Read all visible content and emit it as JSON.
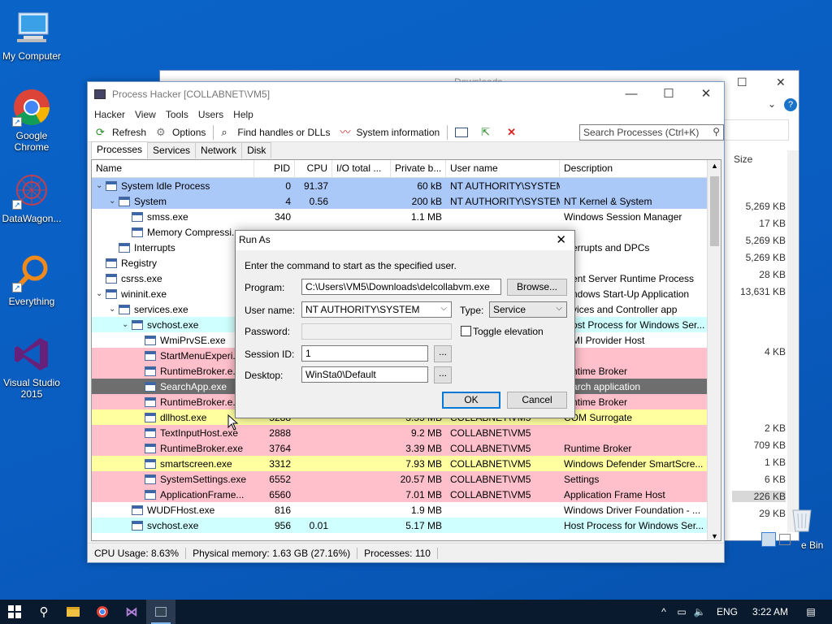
{
  "desktop": {
    "icons": [
      {
        "label": "My Computer",
        "icon": "computer-icon"
      },
      {
        "label": "Google Chrome",
        "icon": "chrome-icon"
      },
      {
        "label": "DataWagon...",
        "icon": "datawagon-icon"
      },
      {
        "label": "Everything",
        "icon": "magnifier-icon"
      },
      {
        "label": "Visual Studio 2015",
        "icon": "visual-studio-icon"
      }
    ]
  },
  "explorer": {
    "title": "Downloads",
    "size_header": "Size",
    "sizes": [
      "5,269 KB",
      "17 KB",
      "5,269 KB",
      "5,269 KB",
      "28 KB",
      "13,631 KB",
      "4 KB",
      "2 KB",
      "709 KB",
      "1 KB",
      "6 KB",
      "226 KB",
      "29 KB"
    ],
    "recycle_bin_partial": "e Bin"
  },
  "process_hacker": {
    "title": "Process Hacker [COLLABNET\\VM5]",
    "menu": [
      "Hacker",
      "View",
      "Tools",
      "Users",
      "Help"
    ],
    "toolbar": {
      "refresh": "Refresh",
      "options": "Options",
      "find_handles": "Find handles or DLLs",
      "system_information": "System information"
    },
    "search_placeholder": "Search Processes (Ctrl+K)",
    "tabs": [
      "Processes",
      "Services",
      "Network",
      "Disk"
    ],
    "columns": {
      "name": "Name",
      "pid": "PID",
      "cpu": "CPU",
      "io": "I/O total ...",
      "private": "Private b...",
      "user": "User name",
      "description": "Description"
    },
    "colors": {
      "system_blue": "#aac8f8",
      "service_cyan": "#d0ffff",
      "immersive_pink": "#ffc0cb",
      "dll_yellow": "#ffffa0",
      "selected_dark": "#6e6e6e"
    },
    "processes": [
      {
        "name": "System Idle Process",
        "indent": 0,
        "expand": "v",
        "pid": "0",
        "cpu": "91.37",
        "io": "",
        "priv": "60 kB",
        "user": "NT AUTHORITY\\SYSTEM",
        "desc": "",
        "color": "blue"
      },
      {
        "name": "System",
        "indent": 1,
        "expand": "v",
        "pid": "4",
        "cpu": "0.56",
        "io": "",
        "priv": "200 kB",
        "user": "NT AUTHORITY\\SYSTEM",
        "desc": "NT Kernel & System",
        "color": "blue"
      },
      {
        "name": "smss.exe",
        "indent": 2,
        "expand": "",
        "pid": "340",
        "cpu": "",
        "io": "",
        "priv": "1.1 MB",
        "user": "",
        "desc": "Windows Session Manager",
        "color": ""
      },
      {
        "name": "Memory Compressi...",
        "indent": 2,
        "expand": "",
        "pid": "",
        "cpu": "",
        "io": "",
        "priv": "",
        "user": "",
        "desc": "",
        "color": ""
      },
      {
        "name": "Interrupts",
        "indent": 1,
        "expand": "",
        "pid": "",
        "cpu": "",
        "io": "",
        "priv": "",
        "user": "",
        "desc": "...errupts and DPCs",
        "color": ""
      },
      {
        "name": "Registry",
        "indent": 0,
        "expand": "",
        "pid": "",
        "cpu": "",
        "io": "",
        "priv": "",
        "user": "",
        "desc": "",
        "color": ""
      },
      {
        "name": "csrss.exe",
        "indent": 0,
        "expand": "",
        "pid": "",
        "cpu": "",
        "io": "",
        "priv": "",
        "user": "",
        "desc": "...ent Server Runtime Process",
        "color": ""
      },
      {
        "name": "wininit.exe",
        "indent": 0,
        "expand": "v",
        "pid": "",
        "cpu": "",
        "io": "",
        "priv": "",
        "user": "",
        "desc": "...ndows Start-Up Application",
        "color": ""
      },
      {
        "name": "services.exe",
        "indent": 1,
        "expand": "v",
        "pid": "",
        "cpu": "",
        "io": "",
        "priv": "",
        "user": "",
        "desc": "...vices and Controller app",
        "color": ""
      },
      {
        "name": "svchost.exe",
        "indent": 2,
        "expand": "v",
        "pid": "",
        "cpu": "",
        "io": "",
        "priv": "",
        "user": "",
        "desc": "...ost Process for Windows Ser...",
        "color": "cyan"
      },
      {
        "name": "WmiPrvSE.exe",
        "indent": 3,
        "expand": "",
        "pid": "",
        "cpu": "",
        "io": "",
        "priv": "",
        "user": "",
        "desc": "...MI Provider Host",
        "color": ""
      },
      {
        "name": "StartMenuExperi...",
        "indent": 3,
        "expand": "",
        "pid": "",
        "cpu": "",
        "io": "",
        "priv": "",
        "user": "",
        "desc": "",
        "color": "pink"
      },
      {
        "name": "RuntimeBroker.e...",
        "indent": 3,
        "expand": "",
        "pid": "",
        "cpu": "",
        "io": "",
        "priv": "",
        "user": "",
        "desc": "...ntime Broker",
        "color": "pink"
      },
      {
        "name": "SearchApp.exe",
        "indent": 3,
        "expand": "",
        "pid": "",
        "cpu": "",
        "io": "",
        "priv": "",
        "user": "",
        "desc": "...arch application",
        "color": "selected"
      },
      {
        "name": "RuntimeBroker.e...",
        "indent": 3,
        "expand": "",
        "pid": "",
        "cpu": "",
        "io": "",
        "priv": "",
        "user": "",
        "desc": "...ntime Broker",
        "color": "pink"
      },
      {
        "name": "dllhost.exe",
        "indent": 3,
        "expand": "",
        "pid": "5288",
        "cpu": "",
        "io": "",
        "priv": "3.55 MB",
        "user": "COLLABNET\\VM5",
        "desc": "COM Surrogate",
        "color": "yellow"
      },
      {
        "name": "TextInputHost.exe",
        "indent": 3,
        "expand": "",
        "pid": "2888",
        "cpu": "",
        "io": "",
        "priv": "9.2 MB",
        "user": "COLLABNET\\VM5",
        "desc": "",
        "color": "pink"
      },
      {
        "name": "RuntimeBroker.exe",
        "indent": 3,
        "expand": "",
        "pid": "3764",
        "cpu": "",
        "io": "",
        "priv": "3.39 MB",
        "user": "COLLABNET\\VM5",
        "desc": "Runtime Broker",
        "color": "pink"
      },
      {
        "name": "smartscreen.exe",
        "indent": 3,
        "expand": "",
        "pid": "3312",
        "cpu": "",
        "io": "",
        "priv": "7.93 MB",
        "user": "COLLABNET\\VM5",
        "desc": "Windows Defender SmartScre...",
        "color": "yellow"
      },
      {
        "name": "SystemSettings.exe",
        "indent": 3,
        "expand": "",
        "pid": "6552",
        "cpu": "",
        "io": "",
        "priv": "20.57 MB",
        "user": "COLLABNET\\VM5",
        "desc": "Settings",
        "color": "pink"
      },
      {
        "name": "ApplicationFrame...",
        "indent": 3,
        "expand": "",
        "pid": "6560",
        "cpu": "",
        "io": "",
        "priv": "7.01 MB",
        "user": "COLLABNET\\VM5",
        "desc": "Application Frame Host",
        "color": "pink"
      },
      {
        "name": "WUDFHost.exe",
        "indent": 2,
        "expand": "",
        "pid": "816",
        "cpu": "",
        "io": "",
        "priv": "1.9 MB",
        "user": "",
        "desc": "Windows Driver Foundation - ...",
        "color": ""
      },
      {
        "name": "svchost.exe",
        "indent": 2,
        "expand": "",
        "pid": "956",
        "cpu": "0.01",
        "io": "",
        "priv": "5.17 MB",
        "user": "",
        "desc": "Host Process for Windows Ser...",
        "color": "cyan"
      }
    ],
    "status": {
      "cpu": "CPU Usage: 8.63%",
      "memory": "Physical memory: 1.63 GB (27.16%)",
      "processes": "Processes: 110"
    }
  },
  "run_as": {
    "title": "Run As",
    "instruction": "Enter the command to start as the specified user.",
    "program_label": "Program:",
    "program_value": "C:\\Users\\VM5\\Downloads\\delcollabvm.exe",
    "browse": "Browse...",
    "user_label": "User name:",
    "user_value": "NT AUTHORITY\\SYSTEM",
    "type_label": "Type:",
    "type_value": "Service",
    "password_label": "Password:",
    "toggle_elevation": "Toggle elevation",
    "session_label": "Session ID:",
    "session_value": "1",
    "desktop_label": "Desktop:",
    "desktop_value": "WinSta0\\Default",
    "ellipsis": "...",
    "ok": "OK",
    "cancel": "Cancel"
  },
  "taskbar": {
    "language": "ENG",
    "time": "3:22 AM"
  }
}
